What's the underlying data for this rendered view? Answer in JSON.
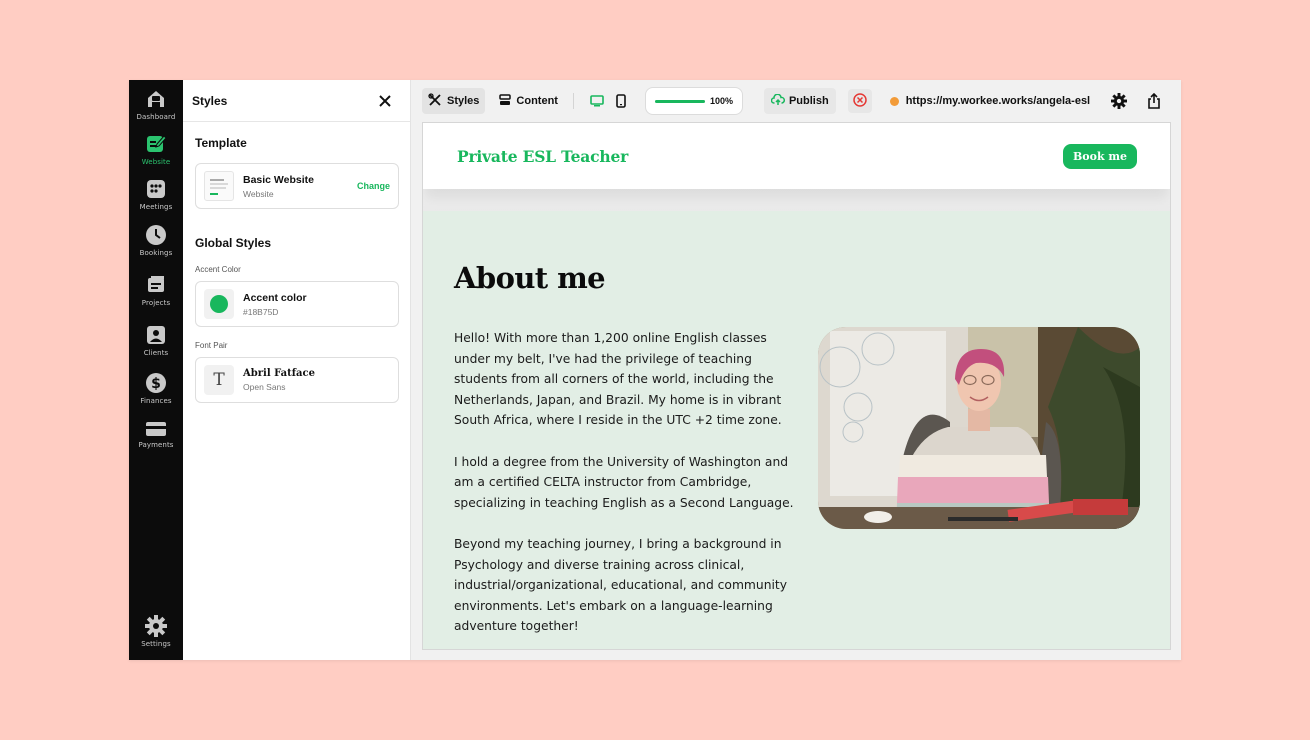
{
  "colors": {
    "accent": "#18B75D",
    "page_background": "#FFCDC3",
    "sidebar_background": "#0C0C0C",
    "canvas_background": "#E2EEE5",
    "url_status_dot": "#F29B38",
    "unpublish_icon": "#E53935"
  },
  "nav": {
    "items": [
      {
        "label": "Dashboard",
        "icon": "home-icon",
        "active": false
      },
      {
        "label": "Website",
        "icon": "website-edit-icon",
        "active": true
      },
      {
        "label": "Meetings",
        "icon": "meetings-icon",
        "active": false
      },
      {
        "label": "Bookings",
        "icon": "clock-icon",
        "active": false
      },
      {
        "label": "Projects",
        "icon": "projects-icon",
        "active": false
      },
      {
        "label": "Clients",
        "icon": "clients-icon",
        "active": false
      },
      {
        "label": "Finances",
        "icon": "dollar-icon",
        "active": false
      },
      {
        "label": "Payments",
        "icon": "card-icon",
        "active": false
      }
    ],
    "settings_label": "Settings"
  },
  "panel": {
    "title": "Styles",
    "template_section": "Template",
    "template_name": "Basic Website",
    "template_type": "Website",
    "change_label": "Change",
    "global_styles_section": "Global Styles",
    "accent_color_label": "Accent Color",
    "accent_card_title": "Accent color",
    "accent_card_value": "#18B75D",
    "font_pair_label": "Font Pair",
    "heading_font": "Abril Fatface",
    "body_font": "Open Sans"
  },
  "toolbar": {
    "styles_label": "Styles",
    "content_label": "Content",
    "zoom_value": "100%",
    "zoom_fraction": 1.0,
    "publish_label": "Publish",
    "site_url": "https://my.workee.works/angela-esl"
  },
  "site": {
    "title": "Private ESL Teacher",
    "book_button": "Book me",
    "about_heading": "About me",
    "paragraphs": [
      "Hello! With more than 1,200 online English classes under my belt, I've had the privilege of teaching students from all corners of the world, including the Netherlands, Japan, and Brazil. My home is in vibrant South Africa, where I reside in the UTC +2 time zone.",
      "I hold a degree from the University of Washington and am a certified CELTA instructor from Cambridge, specializing in teaching English as a Second Language.",
      "Beyond my teaching journey, I bring a background in Psychology and diverse training across clinical, industrial/organizational, educational, and community environments. Let's embark on a language-learning adventure together!"
    ]
  },
  "help_label": "?"
}
